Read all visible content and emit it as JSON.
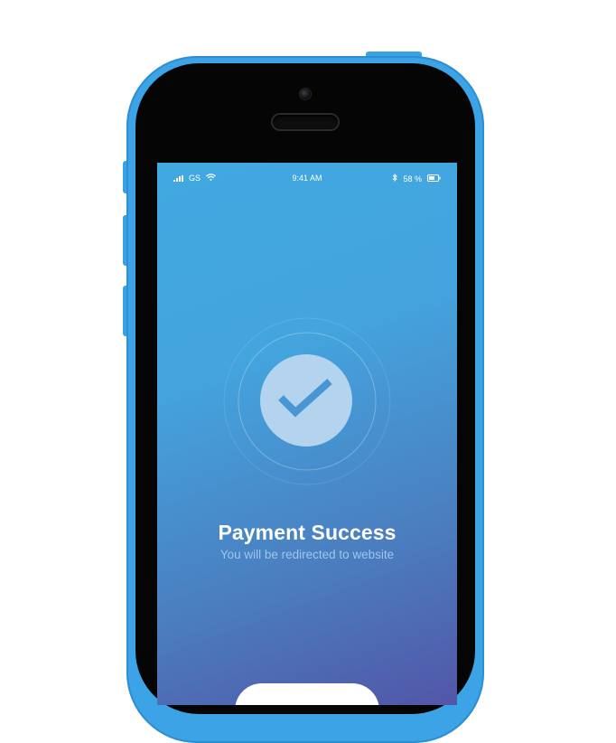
{
  "status_bar": {
    "carrier": "GS",
    "time": "9:41 AM",
    "battery_percent": "58 %"
  },
  "icons": {
    "signal": "signal-bars-icon",
    "wifi": "wifi-icon",
    "bluetooth": "bluetooth-icon",
    "battery": "battery-icon",
    "success": "checkmark-icon"
  },
  "payment": {
    "title": "Payment Success",
    "subtitle": "You will be redirected to website"
  },
  "colors": {
    "device_body": "#3ba3e6",
    "screen_gradient_top": "#41a8e0",
    "screen_gradient_bottom": "#5256a8",
    "check_circle": "#b3d3ee",
    "check_mark": "#4a95d4"
  }
}
